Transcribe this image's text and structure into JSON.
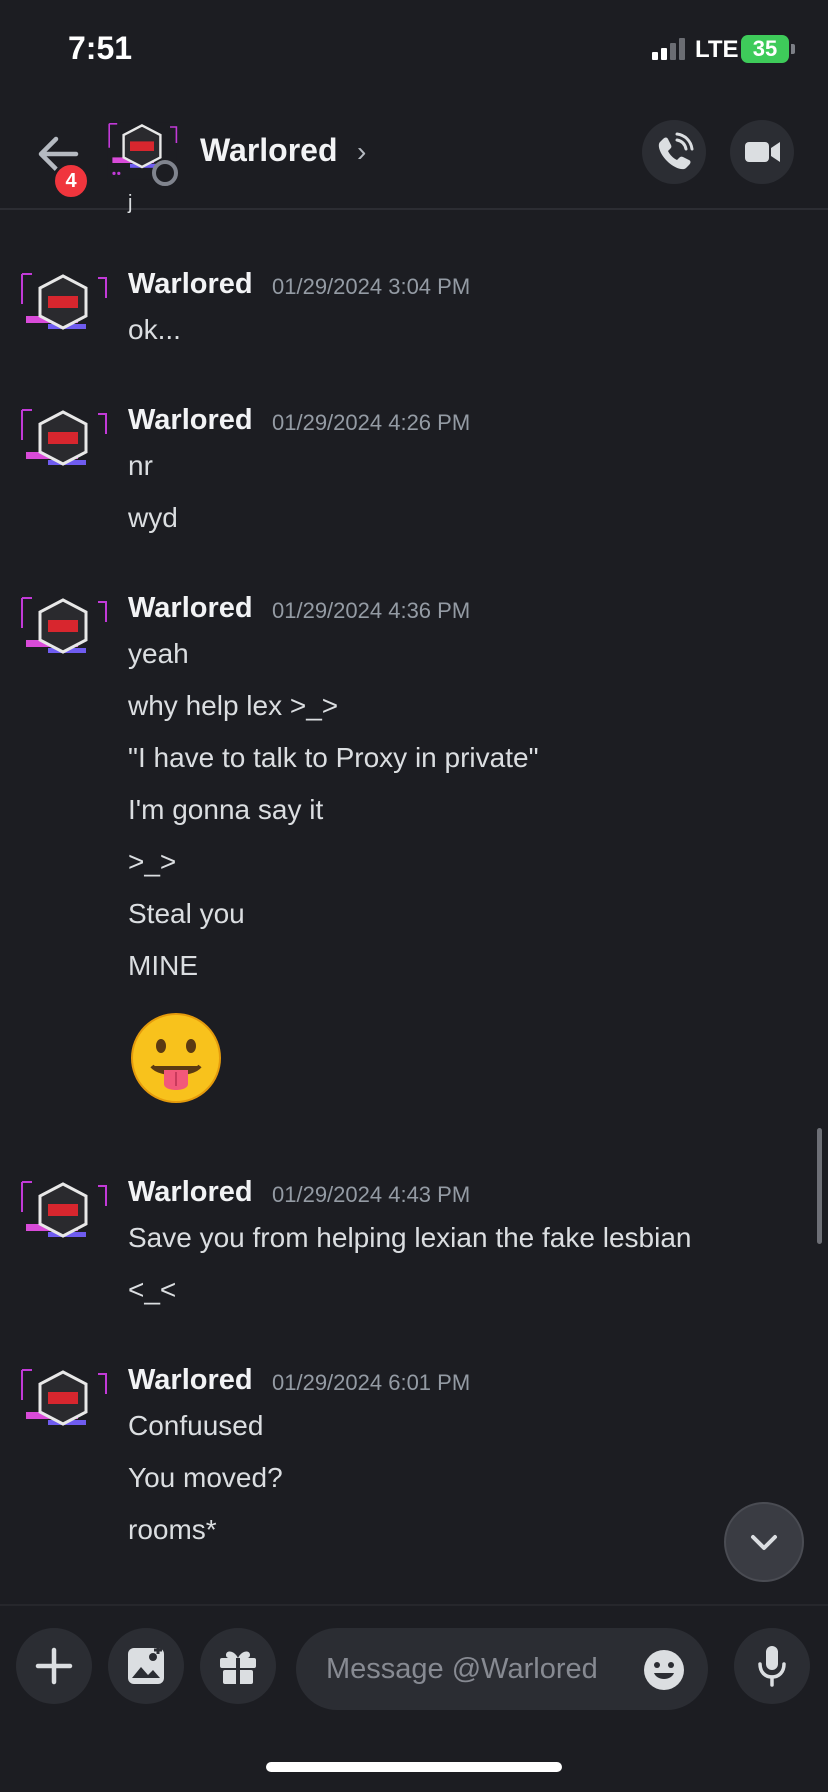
{
  "status_bar": {
    "time": "7:51",
    "network": "LTE",
    "battery": "35"
  },
  "header": {
    "back_badge_count": "4",
    "title": "Warlored",
    "chevron": "›"
  },
  "conversation": {
    "groups": [
      {
        "author": "Warlored",
        "timestamp": "01/29/2024 3:04 PM",
        "lines": [
          "ok..."
        ]
      },
      {
        "author": "Warlored",
        "timestamp": "01/29/2024 4:26 PM",
        "lines": [
          "nr",
          "wyd"
        ]
      },
      {
        "author": "Warlored",
        "timestamp": "01/29/2024 4:36 PM",
        "lines": [
          "yeah",
          "why help lex >_>",
          "\"I have to talk to Proxy in private\"",
          "I'm gonna say it",
          ">_>",
          "Steal you",
          "MINE"
        ],
        "emoji": "face-with-tongue"
      },
      {
        "author": "Warlored",
        "timestamp": "01/29/2024 4:43 PM",
        "lines": [
          "Save you from helping lexian the fake lesbian",
          "<_<"
        ]
      },
      {
        "author": "Warlored",
        "timestamp": "01/29/2024 6:01 PM",
        "lines": [
          "Confuused",
          "You moved?",
          "rooms*"
        ]
      }
    ]
  },
  "composer": {
    "placeholder": "Message @Warlored"
  },
  "colors": {
    "background": "#1c1d22",
    "badge": "#f0353d",
    "battery": "#3ecb5a",
    "button": "#2b2d33"
  }
}
